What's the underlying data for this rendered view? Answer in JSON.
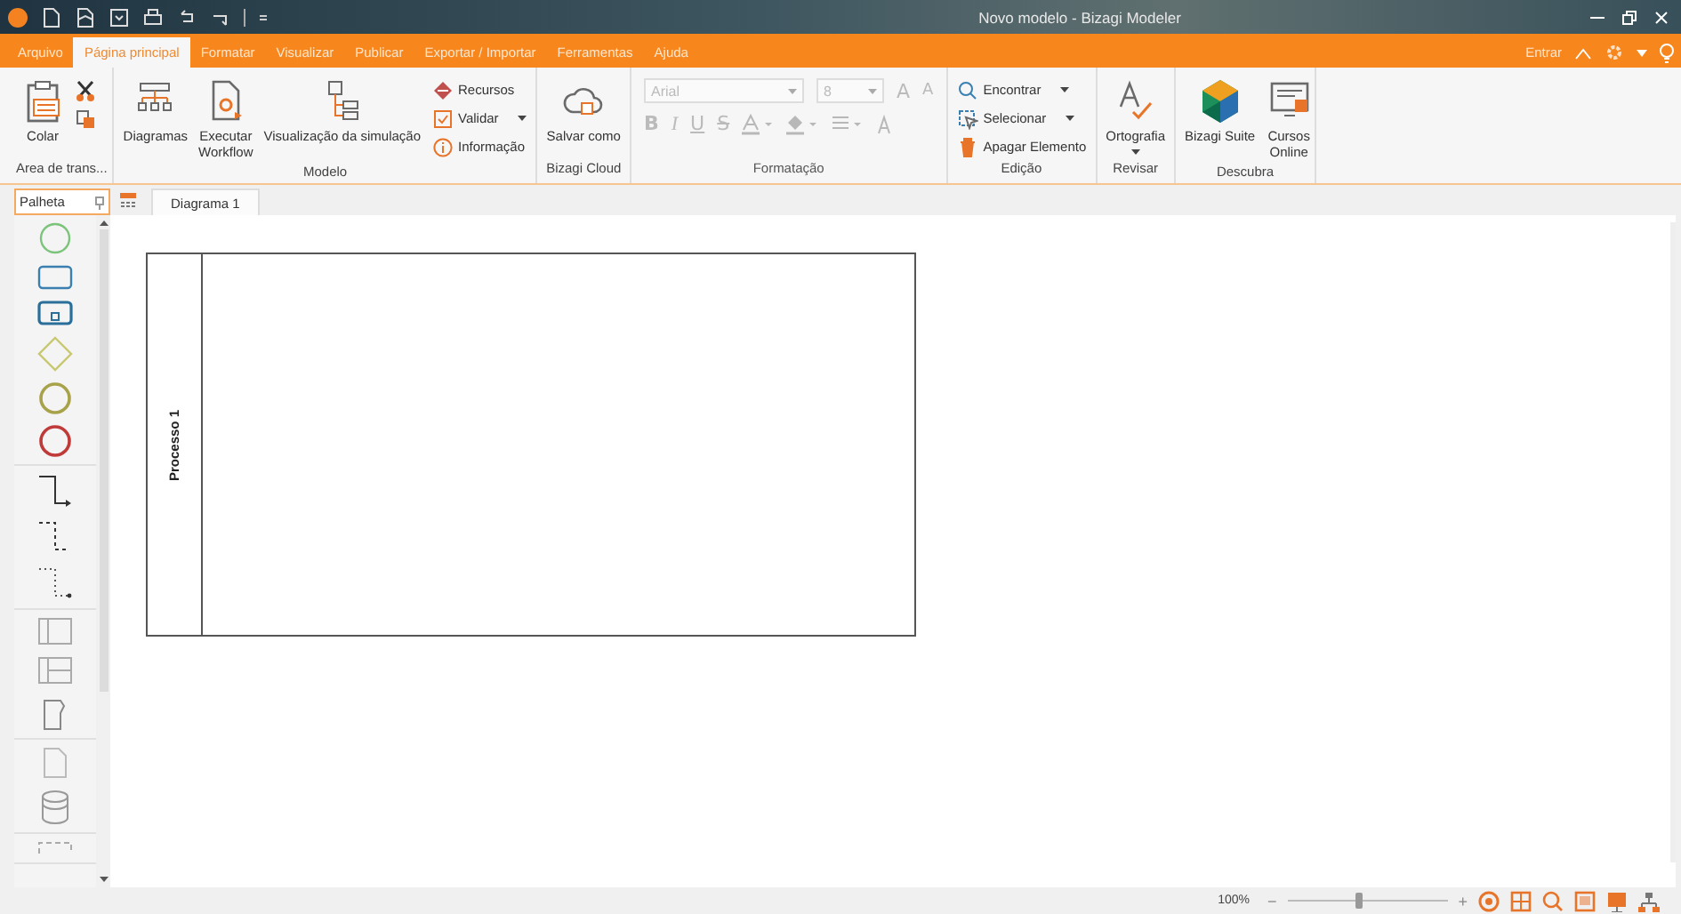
{
  "window": {
    "title": "Novo modelo - Bizagi Modeler"
  },
  "menu_tabs": [
    {
      "label": "Arquivo",
      "selected": false
    },
    {
      "label": "Página principal",
      "selected": true
    },
    {
      "label": "Formatar",
      "selected": false
    },
    {
      "label": "Visualizar",
      "selected": false
    },
    {
      "label": "Publicar",
      "selected": false
    },
    {
      "label": "Exportar / Importar",
      "selected": false
    },
    {
      "label": "Ferramentas",
      "selected": false
    },
    {
      "label": "Ajuda",
      "selected": false
    }
  ],
  "account": {
    "label": "Entrar"
  },
  "ribbon_groups": [
    {
      "label": "Area de trans...",
      "disabled": false,
      "items": [
        {
          "kind": "large",
          "label": "Colar"
        },
        {
          "kind": "stack",
          "items": [
            {
              "dropdown": false
            },
            {
              "dropdown": false
            }
          ]
        }
      ]
    },
    {
      "label": "Modelo",
      "disabled": false,
      "items": [
        {
          "kind": "large",
          "label": "Diagramas"
        },
        {
          "kind": "large",
          "label": "Executar Workflow"
        },
        {
          "kind": "large",
          "label": "Visualização da simulação"
        },
        {
          "kind": "stack",
          "items": [
            {
              "label": "Recursos",
              "dropdown": false
            },
            {
              "label": "Validar",
              "dropdown": true
            },
            {
              "label": "Informação",
              "dropdown": false
            }
          ]
        }
      ]
    },
    {
      "label": "Bizagi Cloud",
      "disabled": false,
      "items": [
        {
          "kind": "large",
          "label": "Salvar como"
        }
      ]
    },
    {
      "label": "Formatação",
      "disabled": true,
      "items": [
        {
          "kind": "format",
          "font": "Arial",
          "size": "8",
          "grow": "A",
          "shrink": "A",
          "styles": [
            "B",
            "I",
            "U",
            "S"
          ]
        }
      ]
    },
    {
      "label": "Edição",
      "disabled": false,
      "items": [
        {
          "kind": "stack",
          "items": [
            {
              "label": "Encontrar",
              "dropdown": true
            },
            {
              "label": "Selecionar",
              "dropdown": true
            },
            {
              "label": "Apagar Elemento",
              "dropdown": false
            }
          ]
        }
      ]
    },
    {
      "label": "Revisar",
      "disabled": false,
      "items": [
        {
          "kind": "large",
          "label": "Ortografia",
          "dropdown": true
        }
      ]
    },
    {
      "label": "Descubra",
      "disabled": false,
      "items": [
        {
          "kind": "large",
          "label": "Bizagi Suite"
        },
        {
          "kind": "large",
          "label": "Cursos Online"
        }
      ]
    }
  ],
  "palette": {
    "title": "Palheta",
    "sections": [
      {
        "tools": [
          {
            "kind": "start"
          },
          {
            "kind": "task"
          },
          {
            "kind": "subprocess"
          },
          {
            "kind": "gateway"
          },
          {
            "kind": "intermediate"
          },
          {
            "kind": "end"
          }
        ]
      },
      {
        "tools": [
          {
            "kind": "flow"
          },
          {
            "kind": "message"
          },
          {
            "kind": "association"
          }
        ]
      },
      {
        "tools": [
          {
            "kind": "pool"
          },
          {
            "kind": "lanes"
          },
          {
            "kind": "annotation"
          }
        ]
      },
      {
        "tools": [
          {
            "kind": "dataobject"
          },
          {
            "kind": "datastore"
          }
        ]
      },
      {
        "tools": [
          {
            "kind": "group"
          }
        ]
      }
    ]
  },
  "document_tabs": [
    {
      "label": "Diagrama 1",
      "selected": true
    }
  ],
  "diagram": {
    "pool": {
      "label": "Processo 1"
    }
  },
  "status_bar": {
    "zoom": "100%",
    "minus": "−",
    "plus": "+",
    "zoom_slider": {
      "level": 0.45
    }
  }
}
